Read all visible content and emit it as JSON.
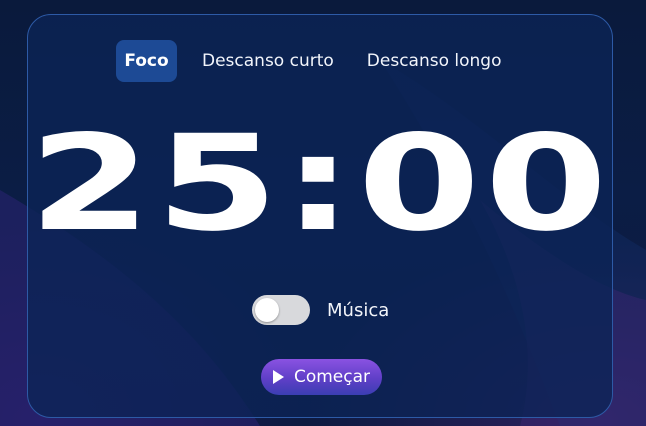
{
  "tabs": [
    {
      "label": "Foco",
      "active": true
    },
    {
      "label": "Descanso curto",
      "active": false
    },
    {
      "label": "Descanso longo",
      "active": false
    }
  ],
  "timer": {
    "display": "25:00"
  },
  "music": {
    "label": "Música",
    "enabled": false
  },
  "start_button": {
    "label": "Começar",
    "icon": "play-icon"
  },
  "colors": {
    "background": "#081633",
    "card": "#0c2456",
    "card_border": "#2d5aa6",
    "active_tab": "#1d4a95",
    "toggle_off": "#d8d9dc",
    "button_gradient_top": "#8a52e2",
    "button_gradient_bottom": "#3b3eb3"
  }
}
